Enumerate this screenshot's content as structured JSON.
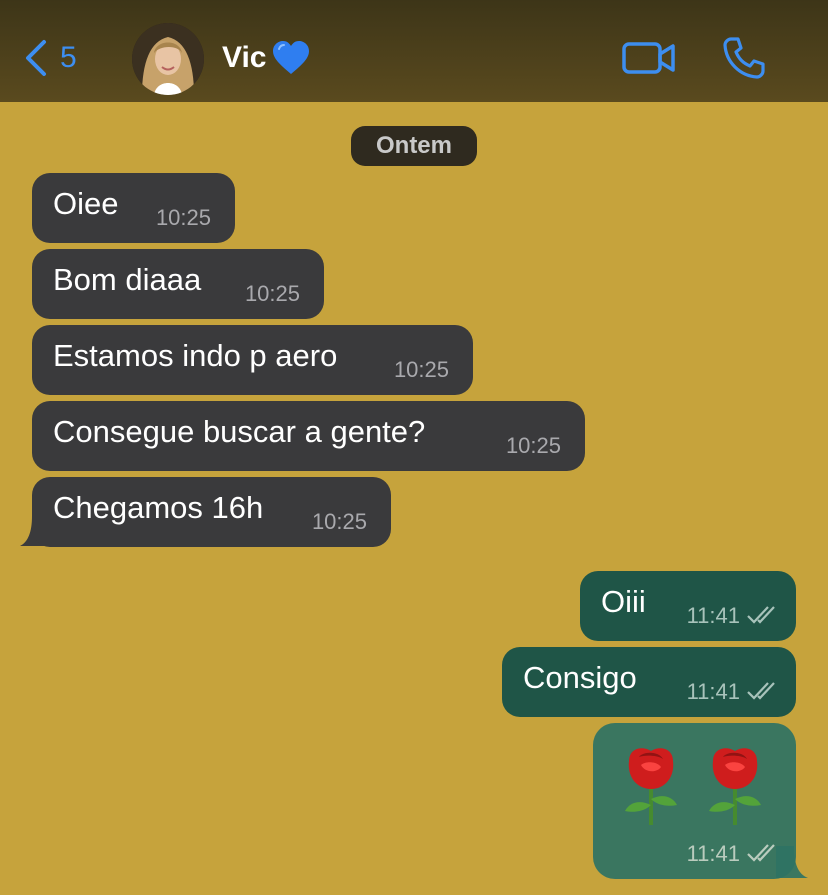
{
  "header": {
    "back_count": "5",
    "contact_name": "Vic",
    "accent_color": "#3d8ef0",
    "icons": [
      "chevron-left-icon",
      "blue-heart-icon",
      "video-camera-icon",
      "phone-icon"
    ]
  },
  "chat": {
    "date_separator": "Ontem",
    "incoming": [
      {
        "text": "Oiee",
        "time": "10:25"
      },
      {
        "text": "Bom diaaa",
        "time": "10:25"
      },
      {
        "text": "Estamos indo p aero",
        "time": "10:25"
      },
      {
        "text": "Consegue buscar a gente?",
        "time": "10:25"
      },
      {
        "text": "Chegamos 16h",
        "time": "10:25"
      }
    ],
    "outgoing": [
      {
        "text": "Oiii",
        "time": "11:41",
        "status": "read"
      },
      {
        "text": "Consigo",
        "time": "11:41",
        "status": "read"
      },
      {
        "text": "🌹🌹",
        "time": "11:41",
        "status": "read",
        "emoji_names": [
          "rose-emoji",
          "rose-emoji"
        ]
      }
    ]
  },
  "colors": {
    "wallpaper": "#c6a33c",
    "incoming_bubble": "#3a3a3c",
    "outgoing_bubble": "#1f5547"
  }
}
